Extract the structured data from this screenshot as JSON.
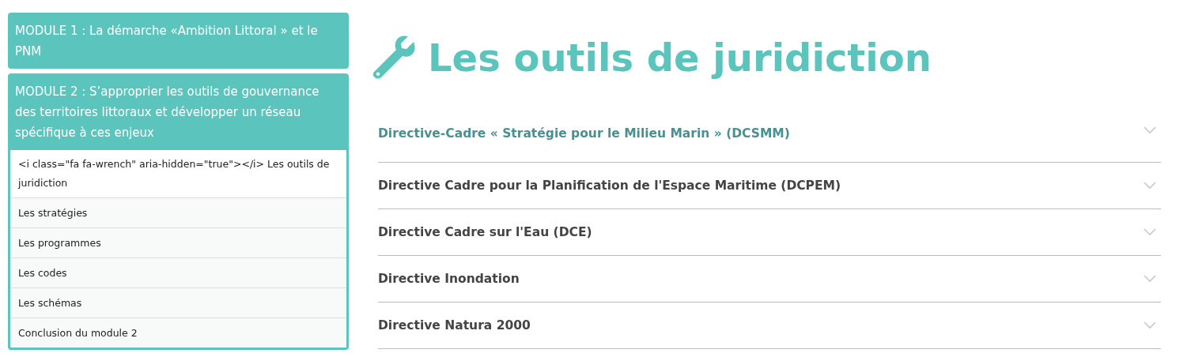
{
  "sidebar": {
    "modules": [
      {
        "title": "MODULE 1 : La démarche «Ambition Littoral » et le PNM",
        "expanded": false
      },
      {
        "title": "MODULE 2 : S’approprier les outils de gouvernance des territoires littoraux et développer un réseau spécifique à ces enjeux",
        "expanded": true,
        "items": [
          {
            "label": "<i class=\"fa fa-wrench\" aria-hidden=\"true\"></i> Les outils de juridiction",
            "selected": true
          },
          {
            "label": "Les stratégies",
            "selected": false
          },
          {
            "label": "Les programmes",
            "selected": false
          },
          {
            "label": "Les codes",
            "selected": false
          },
          {
            "label": "Les schémas",
            "selected": false
          },
          {
            "label": "Conclusion du module 2",
            "selected": false
          }
        ]
      }
    ]
  },
  "page": {
    "title": "Les outils de juridiction"
  },
  "accordion": [
    {
      "label": "Directive-Cadre « Stratégie pour le Milieu Marin » (DCSMM)",
      "selected": true
    },
    {
      "label": "Directive Cadre pour la Planification de l'Espace Maritime (DCPEM)",
      "selected": false
    },
    {
      "label": "Directive Cadre sur l'Eau (DCE)",
      "selected": false
    },
    {
      "label": "Directive Inondation",
      "selected": false
    },
    {
      "label": "Directive Natura 2000",
      "selected": false
    }
  ]
}
